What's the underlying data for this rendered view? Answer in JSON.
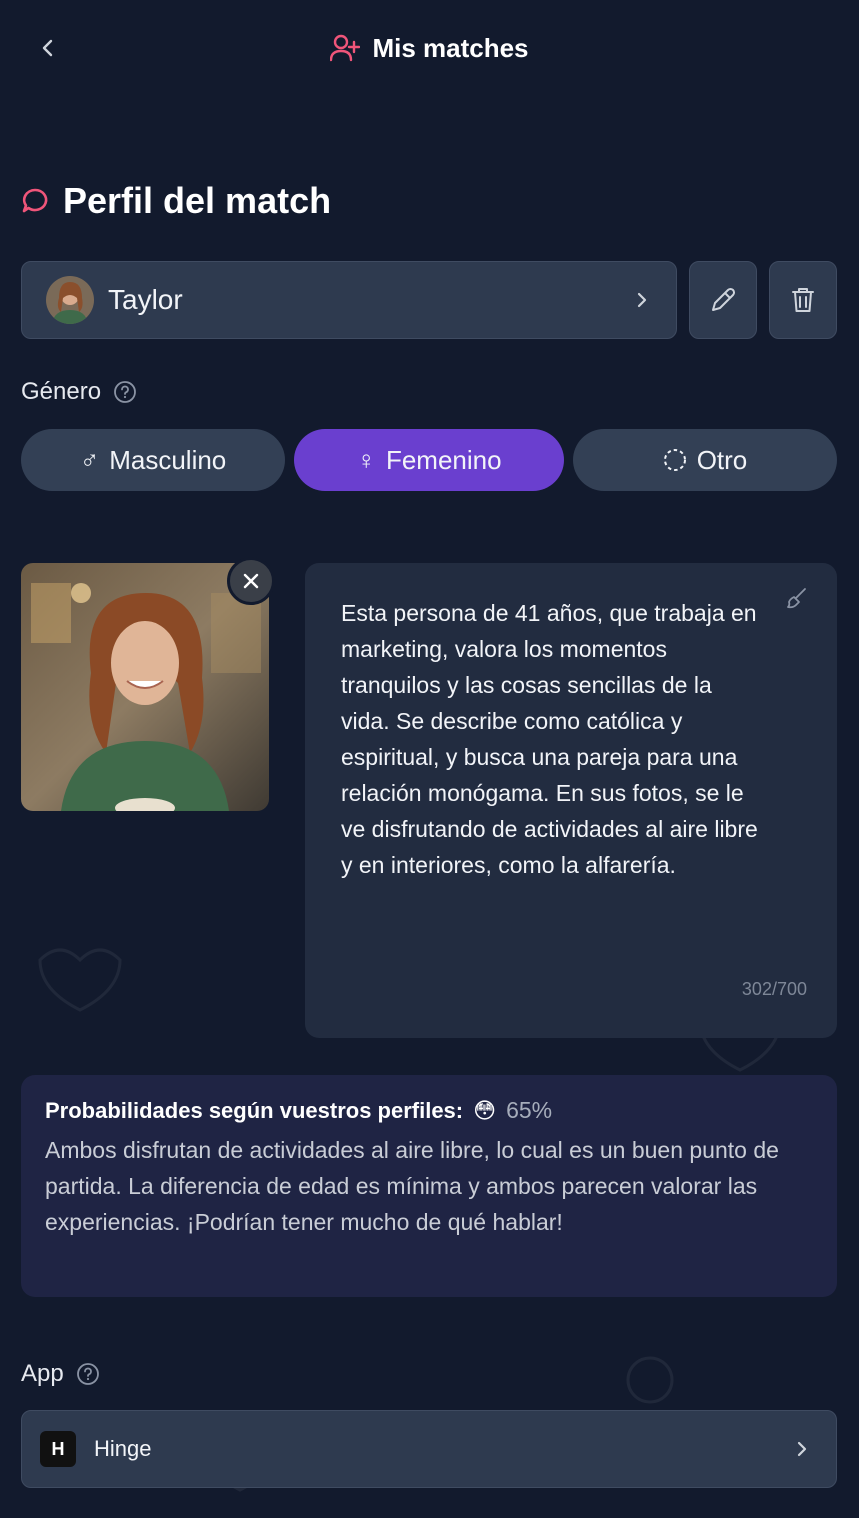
{
  "header": {
    "title": "Mis matches"
  },
  "section": {
    "title": "Perfil del match"
  },
  "match": {
    "name": "Taylor"
  },
  "gender": {
    "label": "Género",
    "options": [
      {
        "label": "Masculino",
        "symbol": "♂"
      },
      {
        "label": "Femenino",
        "symbol": "♀"
      },
      {
        "label": "Otro",
        "symbol": ""
      }
    ],
    "selected": "Femenino"
  },
  "description": {
    "text": "Esta persona de 41 años, que trabaja en marketing, valora los momentos tranquilos y las cosas sencillas de la vida. Se describe como católica y espiritual, y busca una pareja para una relación monógama. En sus fotos, se le ve disfrutando de actividades al aire libre y en interiores, como la alfarería.",
    "char_count": "302/700"
  },
  "probability": {
    "title": "Probabilidades según vuestros perfiles:",
    "emoji": "😳",
    "percent": "65%",
    "text": "Ambos disfrutan de actividades al aire libre, lo cual es un buen punto de partida. La diferencia de edad es mínima y ambos parecen valorar las experiencias. ¡Podrían tener mucho de qué hablar!"
  },
  "app": {
    "label": "App",
    "selected": "Hinge",
    "logo_text": "H"
  },
  "colors": {
    "background": "#121a2d",
    "accent_pink": "#f0557a",
    "selected_purple": "#6a3fcf",
    "card": "#2e3a4f"
  }
}
